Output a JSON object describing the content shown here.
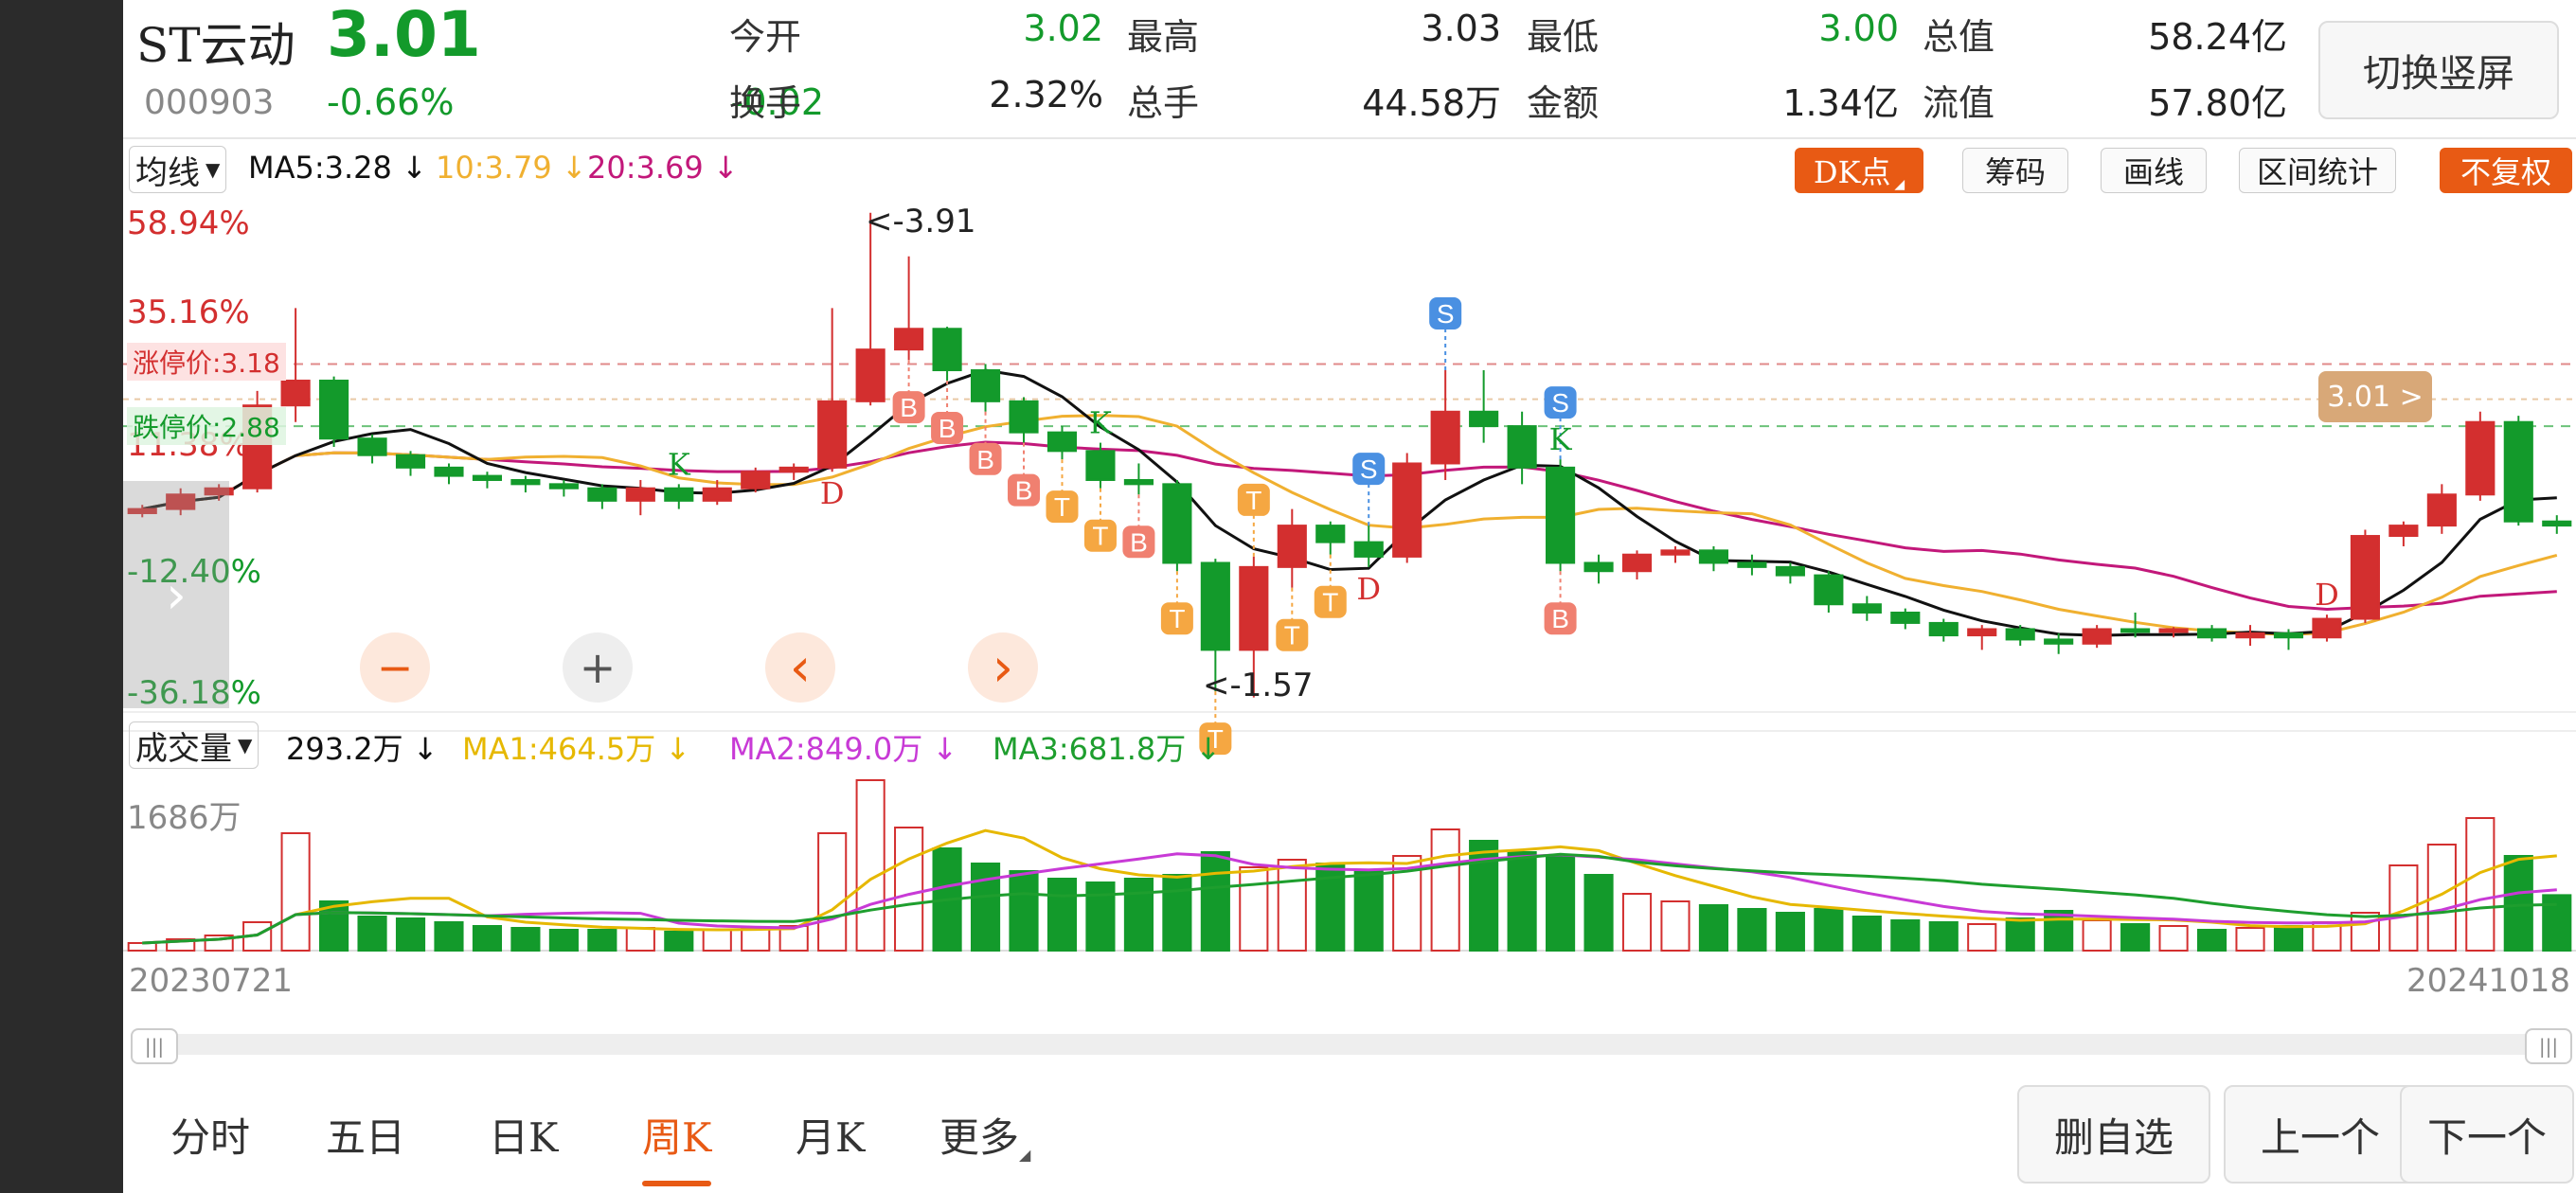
{
  "header": {
    "name": "ST云动",
    "price": "3.01",
    "code": "000903",
    "change_pct": "-0.66%",
    "change": "-0.02",
    "stats": [
      {
        "label": "今开",
        "value": "3.02",
        "color": "green"
      },
      {
        "label": "最高",
        "value": "3.03",
        "color": "normal"
      },
      {
        "label": "最低",
        "value": "3.00",
        "color": "green"
      },
      {
        "label": "总值",
        "value": "58.24亿",
        "color": "normal"
      },
      {
        "label": "换手",
        "value": "2.32%",
        "color": "normal"
      },
      {
        "label": "总手",
        "value": "44.58万",
        "color": "normal"
      },
      {
        "label": "金额",
        "value": "1.34亿",
        "color": "normal"
      },
      {
        "label": "流值",
        "value": "57.80亿",
        "color": "normal"
      }
    ],
    "switch_label": "切换竖屏"
  },
  "ma_bar": {
    "selector": "均线",
    "ma5": "MA5:3.28 ↓",
    "ma10": "10:3.79 ↓",
    "ma20": "20:3.69 ↓",
    "tools": [
      "DK点",
      "筹码",
      "画线",
      "区间统计",
      "不复权"
    ]
  },
  "chart_labels": {
    "pct_top": "58.94%",
    "pct_2": "35.16%",
    "limit_up": "涨停价:3.18",
    "pct_3": "11.38%",
    "limit_down": "跌停价:2.88",
    "pct_4": "-12.40%",
    "pct_bottom": "-36.18%",
    "max_mark": "<-3.91",
    "min_mark": "<-1.57",
    "last_price_tag": "3.01 >",
    "zoom_out": "−",
    "zoom_in": "+",
    "prev": "‹",
    "next": "›",
    "expand": "›"
  },
  "volume_bar": {
    "selector": "成交量",
    "vol": "293.2万 ↓",
    "ma1": "MA1:464.5万 ↓",
    "ma2": "MA2:849.0万 ↓",
    "ma3": "MA3:681.8万 ↓",
    "vol_max": "1686万",
    "date_start": "20230721",
    "date_end": "20241018"
  },
  "chart_data": {
    "type": "candlestick",
    "period": "weekly",
    "date_range": [
      "20230721",
      "20241018"
    ],
    "y_range_pct": [
      -36.18,
      58.94
    ],
    "limit_up": 3.18,
    "limit_down": 2.88,
    "max_price": 3.91,
    "min_price": 1.57,
    "last_price": 3.01,
    "ohlc": [
      [
        2.46,
        2.5,
        2.44,
        2.48
      ],
      [
        2.48,
        2.58,
        2.45,
        2.55
      ],
      [
        2.55,
        2.6,
        2.52,
        2.58
      ],
      [
        2.58,
        3.05,
        2.56,
        2.98
      ],
      [
        2.98,
        3.45,
        2.9,
        3.1
      ],
      [
        3.1,
        3.12,
        2.78,
        2.82
      ],
      [
        2.82,
        2.84,
        2.7,
        2.74
      ],
      [
        2.74,
        2.76,
        2.64,
        2.68
      ],
      [
        2.68,
        2.7,
        2.6,
        2.64
      ],
      [
        2.64,
        2.66,
        2.58,
        2.62
      ],
      [
        2.62,
        2.64,
        2.56,
        2.6
      ],
      [
        2.6,
        2.62,
        2.54,
        2.58
      ],
      [
        2.58,
        2.6,
        2.48,
        2.52
      ],
      [
        2.52,
        2.62,
        2.45,
        2.58
      ],
      [
        2.58,
        2.6,
        2.48,
        2.52
      ],
      [
        2.52,
        2.62,
        2.5,
        2.58
      ],
      [
        2.58,
        2.68,
        2.56,
        2.66
      ],
      [
        2.66,
        2.7,
        2.62,
        2.68
      ],
      [
        2.68,
        3.45,
        2.66,
        3.0
      ],
      [
        3.0,
        3.91,
        2.98,
        3.25
      ],
      [
        3.25,
        3.7,
        3.2,
        3.35
      ],
      [
        3.35,
        3.36,
        3.1,
        3.15
      ],
      [
        3.15,
        3.18,
        2.95,
        3.0
      ],
      [
        3.0,
        3.02,
        2.8,
        2.85
      ],
      [
        2.85,
        2.88,
        2.72,
        2.76
      ],
      [
        2.76,
        2.8,
        2.58,
        2.62
      ],
      [
        2.62,
        2.7,
        2.55,
        2.6
      ],
      [
        2.6,
        2.62,
        2.18,
        2.22
      ],
      [
        2.22,
        2.24,
        1.6,
        1.8
      ],
      [
        1.8,
        2.25,
        1.57,
        2.2
      ],
      [
        2.2,
        2.48,
        2.1,
        2.4
      ],
      [
        2.4,
        2.42,
        2.26,
        2.32
      ],
      [
        2.32,
        2.4,
        2.2,
        2.25
      ],
      [
        2.25,
        2.75,
        2.22,
        2.7
      ],
      [
        2.7,
        3.15,
        2.62,
        2.95
      ],
      [
        2.95,
        3.15,
        2.8,
        2.88
      ],
      [
        2.88,
        2.95,
        2.6,
        2.68
      ],
      [
        2.68,
        2.72,
        2.18,
        2.22
      ],
      [
        2.22,
        2.26,
        2.12,
        2.18
      ],
      [
        2.18,
        2.28,
        2.14,
        2.26
      ],
      [
        2.26,
        2.3,
        2.22,
        2.28
      ],
      [
        2.28,
        2.3,
        2.18,
        2.22
      ],
      [
        2.22,
        2.26,
        2.16,
        2.2
      ],
      [
        2.2,
        2.22,
        2.12,
        2.16
      ],
      [
        2.16,
        2.18,
        1.98,
        2.02
      ],
      [
        2.02,
        2.06,
        1.94,
        1.98
      ],
      [
        1.98,
        2.0,
        1.9,
        1.93
      ],
      [
        1.93,
        1.95,
        1.84,
        1.87
      ],
      [
        1.87,
        1.92,
        1.8,
        1.9
      ],
      [
        1.9,
        1.92,
        1.82,
        1.85
      ],
      [
        1.85,
        1.88,
        1.78,
        1.83
      ],
      [
        1.83,
        1.92,
        1.81,
        1.9
      ],
      [
        1.9,
        1.98,
        1.86,
        1.89
      ],
      [
        1.89,
        1.91,
        1.86,
        1.9
      ],
      [
        1.9,
        1.92,
        1.84,
        1.86
      ],
      [
        1.86,
        1.92,
        1.82,
        1.88
      ],
      [
        1.88,
        1.9,
        1.8,
        1.86
      ],
      [
        1.86,
        1.97,
        1.84,
        1.95
      ],
      [
        1.95,
        2.38,
        1.93,
        2.35
      ],
      [
        2.35,
        2.42,
        2.3,
        2.4
      ],
      [
        2.4,
        2.6,
        2.36,
        2.55
      ],
      [
        2.55,
        2.95,
        2.52,
        2.9
      ],
      [
        2.9,
        2.93,
        2.4,
        2.42
      ],
      [
        2.42,
        2.45,
        2.36,
        2.4
      ]
    ],
    "volume": [
      40,
      60,
      80,
      150,
      620,
      260,
      180,
      170,
      150,
      130,
      120,
      110,
      110,
      120,
      100,
      110,
      120,
      130,
      620,
      900,
      650,
      540,
      460,
      420,
      380,
      360,
      380,
      400,
      520,
      440,
      480,
      460,
      420,
      500,
      640,
      580,
      520,
      500,
      400,
      300,
      260,
      240,
      220,
      200,
      220,
      180,
      160,
      150,
      140,
      170,
      210,
      160,
      140,
      130,
      110,
      120,
      130,
      150,
      200,
      450,
      560,
      700,
      500,
      293
    ],
    "ma_series": [
      {
        "name": "MA5",
        "value": 3.28
      },
      {
        "name": "MA10",
        "value": 3.79
      },
      {
        "name": "MA20",
        "value": 3.69
      }
    ],
    "volume_ma": [
      {
        "name": "MA1",
        "value": "464.5万"
      },
      {
        "name": "MA2",
        "value": "849.0万"
      },
      {
        "name": "MA3",
        "value": "681.8万"
      }
    ],
    "colors": {
      "up": "#d32f2f",
      "down": "#139a2b",
      "ma5": "#111111",
      "ma10": "#f0b030",
      "ma20": "#c2187a",
      "vma1": "#e6b800",
      "vma2": "#c83ad6",
      "vma3": "#1e9e2e",
      "accent": "#e85a14"
    }
  },
  "bottom": {
    "tabs": [
      "分时",
      "五日",
      "日K",
      "周K",
      "月K",
      "更多"
    ],
    "active_tab": 3,
    "buttons": [
      "删自选",
      "上一个",
      "下一个"
    ]
  }
}
